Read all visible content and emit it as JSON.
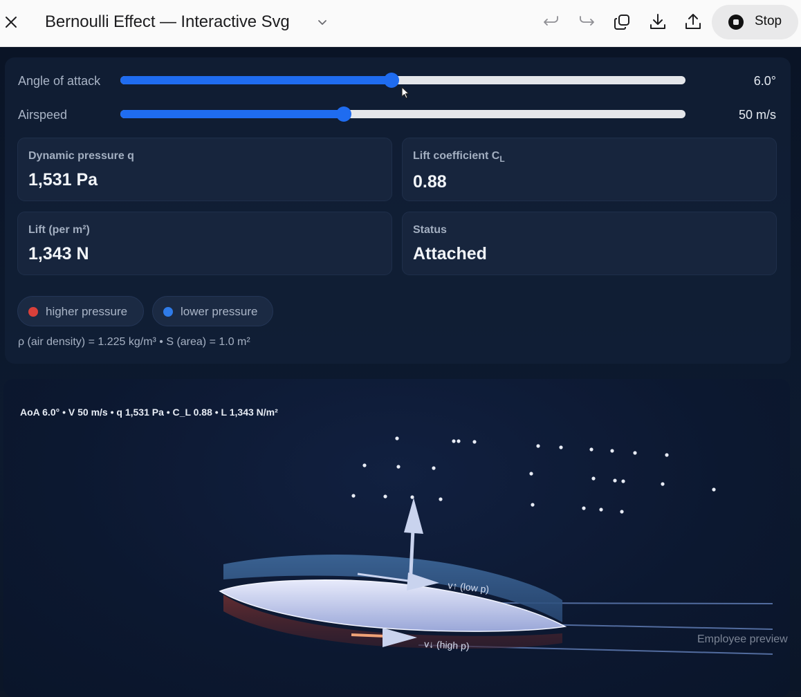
{
  "window": {
    "title": "Bernoulli Effect — Interactive Svg",
    "stop_label": "Stop",
    "toolbar_icons": [
      "close-icon",
      "chevron-down-icon",
      "undo-icon",
      "redo-icon",
      "duplicate-icon",
      "download-icon",
      "share-icon",
      "stop-icon"
    ]
  },
  "controls": {
    "angle": {
      "label": "Angle of attack",
      "value_text": "6.0°",
      "fraction": 0.48
    },
    "airspeed": {
      "label": "Airspeed",
      "value_text": "50 m/s",
      "fraction": 0.395
    }
  },
  "cards": {
    "q": {
      "label": "Dynamic pressure q",
      "value": "1,531 Pa"
    },
    "cl": {
      "label": "Lift coefficient C",
      "label_sub": "L",
      "value": "0.88"
    },
    "lift": {
      "label": "Lift (per m²)",
      "value": "1,343 N"
    },
    "status": {
      "label": "Status",
      "value": "Attached"
    }
  },
  "legend": {
    "high": {
      "label": "higher pressure",
      "color": "#d9403a"
    },
    "low": {
      "label": "lower pressure",
      "color": "#2f7be8"
    }
  },
  "footnote": "ρ (air density) = 1.225 kg/m³ • S (area) = 1.0 m²",
  "viz": {
    "readout": "AoA 6.0° • V 50 m/s • q 1,531 Pa • C_L 0.88 • L 1,343 N/m²",
    "upper_label": "v↑ (low p)",
    "lower_label": "v↓ (high p)",
    "colors": {
      "airfoil": "#c8d0f0",
      "low_band": "#3a5d8c",
      "high_band": "#5a2a2c",
      "arrow": "#c9d3ee",
      "lower_flow_tail": "#f0a277"
    }
  },
  "watermark": "Employee preview"
}
